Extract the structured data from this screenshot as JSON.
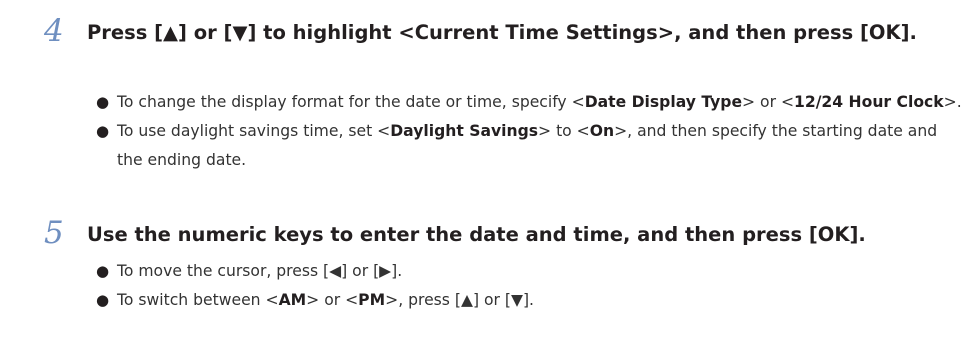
{
  "steps": [
    {
      "number": "4",
      "title": "Press [▲] or [▼] to highlight <Current Time Settings>, and then press [OK].",
      "bullets": [
        {
          "parts": [
            {
              "text": "To change the display format for the date or time, specify <",
              "bold": false
            },
            {
              "text": "Date Display Type",
              "bold": true
            },
            {
              "text": "> or <",
              "bold": false
            },
            {
              "text": "12/24 Hour Clock",
              "bold": true
            },
            {
              "text": ">.",
              "bold": false
            }
          ]
        },
        {
          "parts": [
            {
              "text": "To use daylight savings time, set <",
              "bold": false
            },
            {
              "text": "Daylight Savings",
              "bold": true
            },
            {
              "text": "> to <",
              "bold": false
            },
            {
              "text": "On",
              "bold": true
            },
            {
              "text": ">, and then specify the starting date and the ending date.",
              "bold": false
            }
          ]
        }
      ]
    },
    {
      "number": "5",
      "title": "Use the numeric keys to enter the date and time, and then press [OK].",
      "bullets": [
        {
          "parts": [
            {
              "text": "To move the cursor, press [◀] or [▶].",
              "bold": false
            }
          ]
        },
        {
          "parts": [
            {
              "text": "To switch between <",
              "bold": false
            },
            {
              "text": "AM",
              "bold": true
            },
            {
              "text": "> or <",
              "bold": false
            },
            {
              "text": "PM",
              "bold": true
            },
            {
              "text": ">, press [▲] or [▼].",
              "bold": false
            }
          ]
        }
      ]
    }
  ],
  "colors": {
    "step_number": "#6f8fc0",
    "text": "#231f20"
  }
}
